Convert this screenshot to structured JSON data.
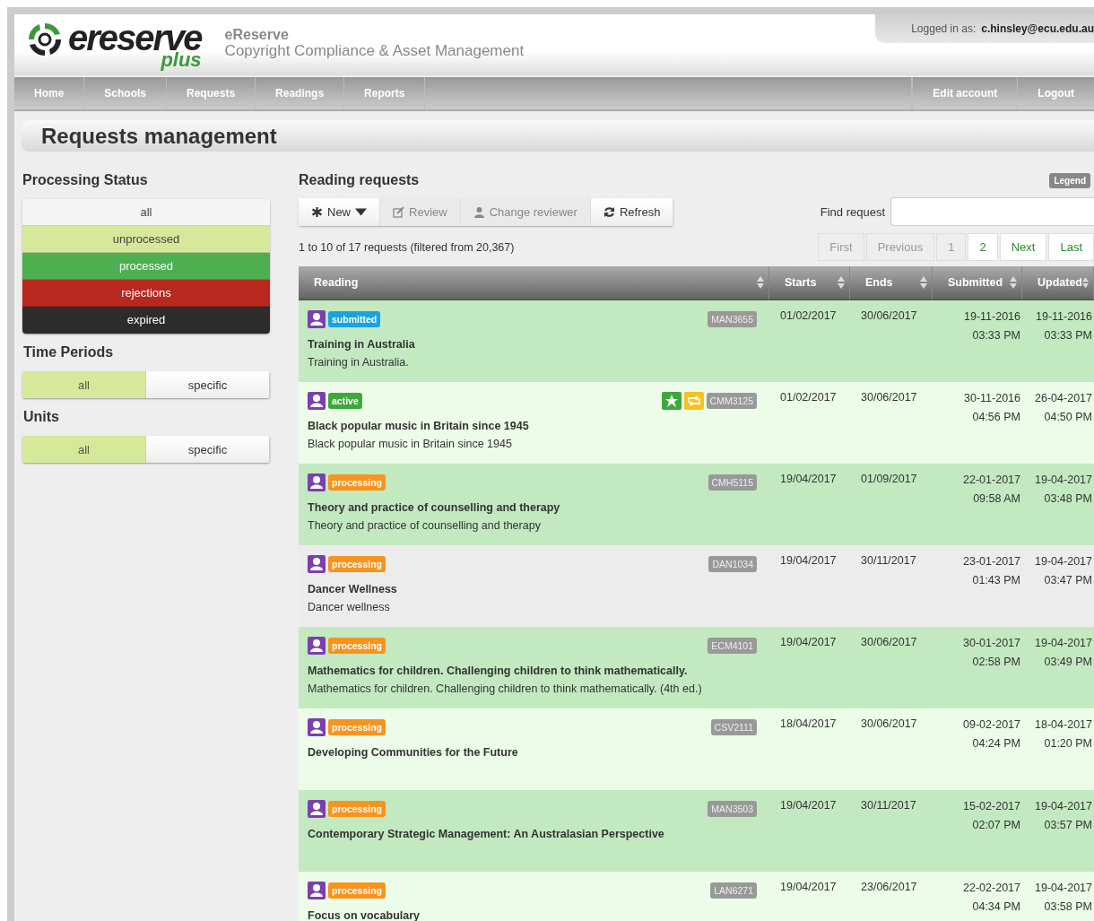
{
  "header": {
    "logo_main": "ereserve",
    "logo_accent": "plus",
    "app_name": "eReserve",
    "tagline": "Copyright Compliance & Asset Management",
    "logged_in_label": "Logged in as:",
    "user": "c.hinsley@ecu.edu.au"
  },
  "nav": {
    "left": [
      "Home",
      "Schools",
      "Requests",
      "Readings",
      "Reports"
    ],
    "right": [
      "Edit account",
      "Logout"
    ]
  },
  "page_title": "Requests management",
  "sidebar": {
    "processing_status": {
      "title": "Processing Status",
      "items": [
        {
          "label": "all",
          "color": "#f4f4f4"
        },
        {
          "label": "unprocessed",
          "color": "#d6e89a"
        },
        {
          "label": "processed",
          "color": "#4caf50"
        },
        {
          "label": "rejections",
          "color": "#b8281f"
        },
        {
          "label": "expired",
          "color": "#2c2c2c"
        }
      ]
    },
    "time_periods": {
      "title": "Time Periods",
      "options": [
        {
          "label": "all",
          "selected": true
        },
        {
          "label": "specific",
          "selected": false
        }
      ]
    },
    "units": {
      "title": "Units",
      "options": [
        {
          "label": "all",
          "selected": true
        },
        {
          "label": "specific",
          "selected": false
        }
      ]
    }
  },
  "main": {
    "title": "Reading requests",
    "legend": "Legend",
    "toolbar": [
      {
        "label": "New",
        "kind": "new",
        "disabled": false
      },
      {
        "label": "Review",
        "kind": "review",
        "disabled": true
      },
      {
        "label": "Change reviewer",
        "kind": "reviewer",
        "disabled": true
      },
      {
        "label": "Refresh",
        "kind": "refresh",
        "disabled": false
      }
    ],
    "search": {
      "label": "Find request"
    },
    "summary": "1 to 10 of 17 requests (filtered from 20,367)",
    "pagination": [
      {
        "label": "First",
        "disabled": true
      },
      {
        "label": "Previous",
        "disabled": true
      },
      {
        "label": "1",
        "disabled": true
      },
      {
        "label": "2",
        "disabled": false
      },
      {
        "label": "Next",
        "disabled": false
      },
      {
        "label": "Last",
        "disabled": false
      }
    ],
    "table": {
      "columns": [
        "Reading",
        "Starts",
        "Ends",
        "Submitted",
        "Updated"
      ],
      "rows": [
        {
          "color": "#c3e9c1",
          "status": {
            "label": "submitted",
            "color": "#1aa3e0"
          },
          "starred": false,
          "repeat": false,
          "code": "MAN3655",
          "title": "Training in Australia",
          "subtitle": "Training in Australia.",
          "starts": "01/02/2017",
          "ends": "30/06/2017",
          "submitted": [
            "19-11-2016",
            "03:33 PM"
          ],
          "updated": [
            "19-11-2016",
            "03:33 PM"
          ]
        },
        {
          "color": "#edfce8",
          "status": {
            "label": "active",
            "color": "#3ea83e"
          },
          "starred": true,
          "repeat": true,
          "code": "CMM3125",
          "title": "Black popular music in Britain since 1945",
          "subtitle": "Black popular music in Britain since 1945",
          "starts": "01/02/2017",
          "ends": "30/06/2017",
          "submitted": [
            "30-11-2016",
            "04:56 PM"
          ],
          "updated": [
            "26-04-2017",
            "04:50 PM"
          ]
        },
        {
          "color": "#c3e9c1",
          "status": {
            "label": "processing",
            "color": "#f7941d"
          },
          "starred": false,
          "repeat": false,
          "code": "CMH5115",
          "title": "Theory and practice of counselling and therapy",
          "subtitle": "Theory and practice of counselling and therapy",
          "starts": "19/04/2017",
          "ends": "01/09/2017",
          "submitted": [
            "22-01-2017",
            "09:58 AM"
          ],
          "updated": [
            "19-04-2017",
            "03:48 PM"
          ]
        },
        {
          "color": "#ececec",
          "status": {
            "label": "processing",
            "color": "#f7941d"
          },
          "starred": false,
          "repeat": false,
          "code": "DAN1034",
          "title": "Dancer Wellness",
          "subtitle": "Dancer wellness",
          "starts": "19/04/2017",
          "ends": "30/11/2017",
          "submitted": [
            "23-01-2017",
            "01:43 PM"
          ],
          "updated": [
            "19-04-2017",
            "03:47 PM"
          ]
        },
        {
          "color": "#c3e9c1",
          "status": {
            "label": "processing",
            "color": "#f7941d"
          },
          "starred": false,
          "repeat": false,
          "code": "ECM4101",
          "title": "Mathematics for children. Challenging children to think mathematically.",
          "subtitle": "Mathematics for children. Challenging children to think mathematically. (4th ed.)",
          "starts": "19/04/2017",
          "ends": "30/06/2017",
          "submitted": [
            "30-01-2017",
            "02:58 PM"
          ],
          "updated": [
            "19-04-2017",
            "03:49 PM"
          ]
        },
        {
          "color": "#edfce8",
          "status": {
            "label": "processing",
            "color": "#f7941d"
          },
          "starred": false,
          "repeat": false,
          "code": "CSV2111",
          "title": "Developing Communities for the Future",
          "starts": "18/04/2017",
          "ends": "30/06/2017",
          "submitted": [
            "09-02-2017",
            "04:24 PM"
          ],
          "updated": [
            "18-04-2017",
            "01:20 PM"
          ]
        },
        {
          "color": "#c3e9c1",
          "status": {
            "label": "processing",
            "color": "#f7941d"
          },
          "starred": false,
          "repeat": false,
          "code": "MAN3503",
          "title": "Contemporary Strategic Management: An Australasian Perspective",
          "starts": "19/04/2017",
          "ends": "30/11/2017",
          "submitted": [
            "15-02-2017",
            "02:07 PM"
          ],
          "updated": [
            "19-04-2017",
            "03:57 PM"
          ]
        },
        {
          "color": "#edfce8",
          "status": {
            "label": "processing",
            "color": "#f7941d"
          },
          "starred": false,
          "repeat": false,
          "code": "LAN6271",
          "title": "Focus on vocabulary",
          "starts": "19/04/2017",
          "ends": "23/06/2017",
          "submitted": [
            "22-02-2017",
            "04:34 PM"
          ],
          "updated": [
            "19-04-2017",
            "03:58 PM"
          ]
        }
      ]
    }
  }
}
